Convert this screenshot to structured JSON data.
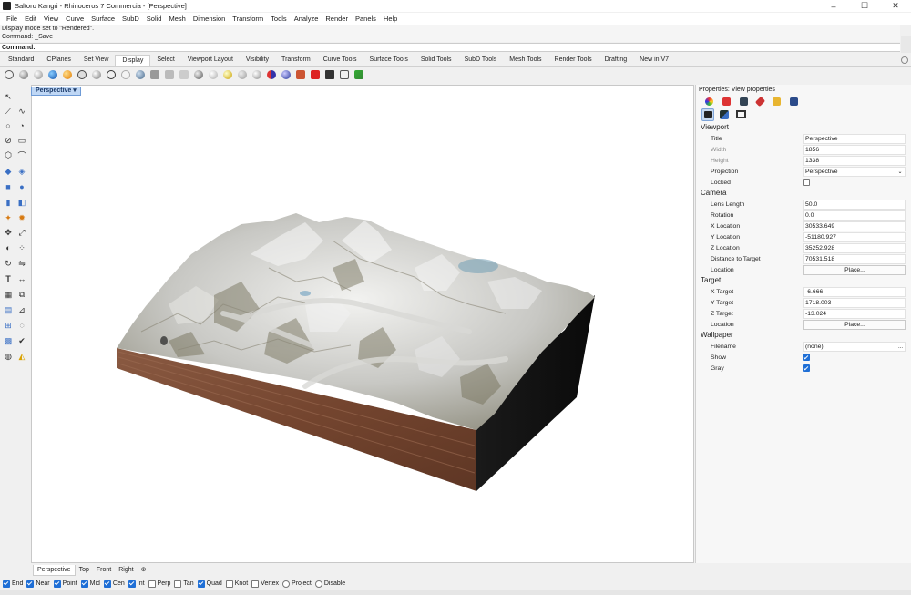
{
  "window": {
    "title": "Saltoro Kangri - Rhinoceros 7 Commercia - [Perspective]",
    "minimize_glyph": "–",
    "maximize_glyph": "☐",
    "close_glyph": "✕"
  },
  "menu": [
    "File",
    "Edit",
    "View",
    "Curve",
    "Surface",
    "SubD",
    "Solid",
    "Mesh",
    "Dimension",
    "Transform",
    "Tools",
    "Analyze",
    "Render",
    "Panels",
    "Help"
  ],
  "command": {
    "history_1": "Display mode set to \"Rendered\".",
    "history_2": "Command: _Save",
    "prompt": "Command:"
  },
  "tabs": [
    "Standard",
    "CPlanes",
    "Set View",
    "Display",
    "Select",
    "Viewport Layout",
    "Visibility",
    "Transform",
    "Curve Tools",
    "Surface Tools",
    "Solid Tools",
    "SubD Tools",
    "Mesh Tools",
    "Render Tools",
    "Drafting",
    "New in V7"
  ],
  "active_tab": "Display",
  "toolbar_icons": [
    "wireframe-icon",
    "shaded-icon",
    "rendered-icon",
    "ghosted-icon",
    "xray-icon",
    "technical-icon",
    "artistic-icon",
    "pen-icon",
    "arctic-icon",
    "raytraced-icon",
    "monochrome-icon",
    "pen-tool-icon",
    "render-preview-icon",
    "sun-icon",
    "light-icon",
    "material-icon",
    "cplane-icon",
    "grid-icon",
    "axes-icon",
    "capture-icon",
    "camera-icon",
    "close-view-icon",
    "monitor-icon",
    "objects-icon",
    "layer-icon"
  ],
  "viewport": {
    "label": "Perspective",
    "tabs": [
      "Perspective",
      "Top",
      "Front",
      "Right"
    ],
    "add_tab": "⊕"
  },
  "osnap": [
    {
      "label": "End",
      "checked": true
    },
    {
      "label": "Near",
      "checked": true
    },
    {
      "label": "Point",
      "checked": true
    },
    {
      "label": "Mid",
      "checked": true
    },
    {
      "label": "Cen",
      "checked": true
    },
    {
      "label": "Int",
      "checked": true
    },
    {
      "label": "Perp",
      "checked": false
    },
    {
      "label": "Tan",
      "checked": false
    },
    {
      "label": "Quad",
      "checked": true
    },
    {
      "label": "Knot",
      "checked": false
    },
    {
      "label": "Vertex",
      "checked": false
    },
    {
      "label": "Project",
      "checked": false
    },
    {
      "label": "Disable",
      "checked": false
    }
  ],
  "properties": {
    "header": "Properties: View properties",
    "sections": {
      "viewport": "Viewport",
      "camera": "Camera",
      "target": "Target",
      "wallpaper": "Wallpaper"
    },
    "viewport_rows": {
      "title_label": "Title",
      "title_value": "Perspective",
      "width_label": "Width",
      "width_value": "1856",
      "height_label": "Height",
      "height_value": "1338",
      "projection_label": "Projection",
      "projection_value": "Perspective",
      "locked_label": "Locked"
    },
    "camera_rows": {
      "lens_label": "Lens Length",
      "lens_value": "50.0",
      "rotation_label": "Rotation",
      "rotation_value": "0.0",
      "xloc_label": "X Location",
      "xloc_value": "30533.649",
      "yloc_label": "Y Location",
      "yloc_value": "-51180.927",
      "zloc_label": "Z Location",
      "zloc_value": "35252.928",
      "dist_label": "Distance to Target",
      "dist_value": "70531.518",
      "location_label": "Location",
      "location_button": "Place..."
    },
    "target_rows": {
      "x_label": "X Target",
      "x_value": "-6.666",
      "y_label": "Y Target",
      "y_value": "1718.003",
      "z_label": "Z Target",
      "z_value": "-13.024",
      "location_label": "Location",
      "location_button": "Place..."
    },
    "wallpaper_rows": {
      "filename_label": "Filename",
      "filename_value": "(none)",
      "browse": "...",
      "show_label": "Show",
      "gray_label": "Gray"
    }
  },
  "colors": {
    "accent": "#1f6fd6",
    "viewport_label_bg": "#bfd7f5",
    "terrain_side": "#7a4a35"
  }
}
